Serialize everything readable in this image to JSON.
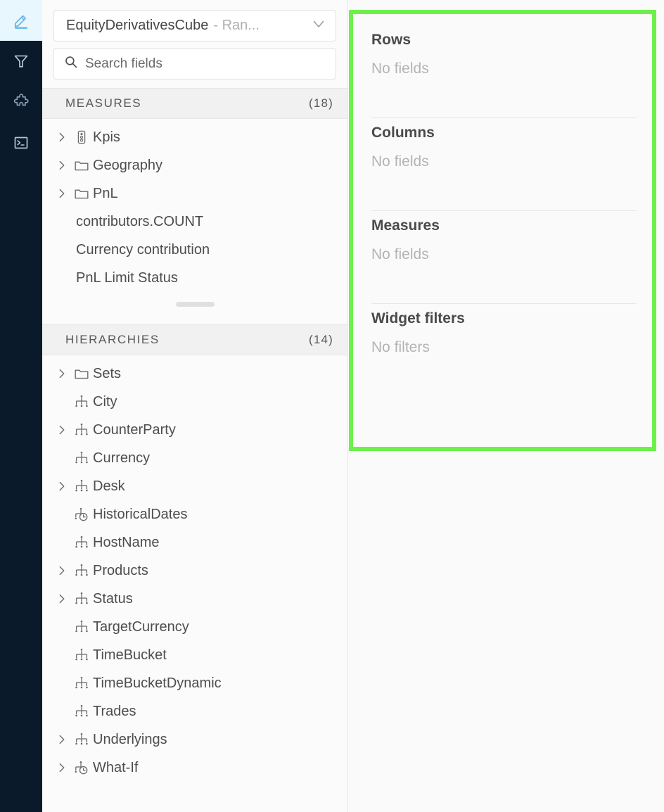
{
  "rail": {
    "items": [
      {
        "icon": "pencil-edit-icon",
        "name": "rail-item-edit",
        "active": true
      },
      {
        "icon": "filter-funnel-icon",
        "name": "rail-item-filters",
        "active": false
      },
      {
        "icon": "puzzle-piece-icon",
        "name": "rail-item-plugins",
        "active": false
      },
      {
        "icon": "terminal-console-icon",
        "name": "rail-item-console",
        "active": false
      }
    ]
  },
  "cube_selector": {
    "name": "EquityDerivativesCube",
    "separator": "-",
    "server": "Ran...",
    "chevron": "chevron-down-icon"
  },
  "search": {
    "placeholder": "Search fields",
    "value": "",
    "icon": "search-icon"
  },
  "measures": {
    "title": "MEASURES",
    "count": "(18)",
    "items": [
      {
        "label": "Kpis",
        "icon": "kpi-icon",
        "expandable": true
      },
      {
        "label": "Geography",
        "icon": "folder-icon",
        "expandable": true
      },
      {
        "label": "PnL",
        "icon": "folder-icon",
        "expandable": true
      },
      {
        "label": "contributors.COUNT",
        "icon": "none",
        "expandable": false
      },
      {
        "label": "Currency contribution",
        "icon": "none",
        "expandable": false
      },
      {
        "label": "PnL Limit Status",
        "icon": "none",
        "expandable": false
      }
    ]
  },
  "hierarchies": {
    "title": "HIERARCHIES",
    "count": "(14)",
    "items": [
      {
        "label": "Sets",
        "icon": "folder-icon",
        "expandable": true
      },
      {
        "label": "City",
        "icon": "hierarchy-icon",
        "expandable": false
      },
      {
        "label": "CounterParty",
        "icon": "hierarchy-icon",
        "expandable": true
      },
      {
        "label": "Currency",
        "icon": "hierarchy-icon",
        "expandable": false
      },
      {
        "label": "Desk",
        "icon": "hierarchy-icon",
        "expandable": true
      },
      {
        "label": "HistoricalDates",
        "icon": "time-hierarchy-icon",
        "expandable": false
      },
      {
        "label": "HostName",
        "icon": "hierarchy-icon",
        "expandable": false
      },
      {
        "label": "Products",
        "icon": "hierarchy-icon",
        "expandable": true
      },
      {
        "label": "Status",
        "icon": "hierarchy-icon",
        "expandable": true
      },
      {
        "label": "TargetCurrency",
        "icon": "hierarchy-icon",
        "expandable": false
      },
      {
        "label": "TimeBucket",
        "icon": "hierarchy-icon",
        "expandable": false
      },
      {
        "label": "TimeBucketDynamic",
        "icon": "hierarchy-icon",
        "expandable": false
      },
      {
        "label": "Trades",
        "icon": "hierarchy-icon",
        "expandable": false
      },
      {
        "label": "Underlyings",
        "icon": "hierarchy-icon",
        "expandable": true
      },
      {
        "label": "What-If",
        "icon": "time-hierarchy-icon",
        "expandable": true
      }
    ]
  },
  "dropzone": {
    "highlight_color": "#6cf04b",
    "blocks": [
      {
        "title": "Rows",
        "empty": "No fields"
      },
      {
        "title": "Columns",
        "empty": "No fields"
      },
      {
        "title": "Measures",
        "empty": "No fields"
      },
      {
        "title": "Widget filters",
        "empty": "No filters"
      }
    ]
  }
}
